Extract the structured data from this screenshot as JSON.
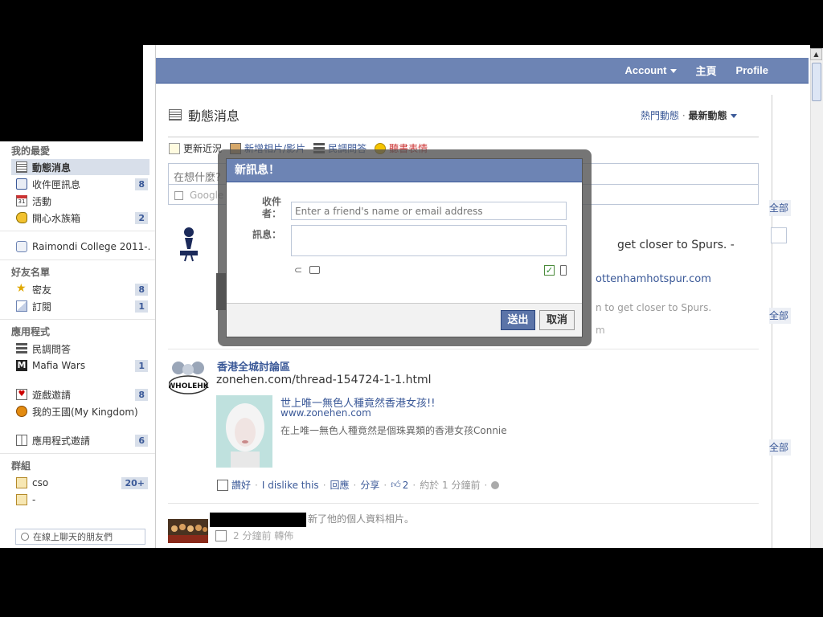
{
  "topbar": {
    "account": "Account",
    "home": "主頁",
    "profile": "Profile"
  },
  "sidebar": {
    "favorites_title": "我的最愛",
    "favorites": [
      {
        "label": "動態消息",
        "count": ""
      },
      {
        "label": "收件匣訊息",
        "count": "8"
      },
      {
        "label": "活動",
        "count": ""
      },
      {
        "label": "開心水族箱",
        "count": "2"
      }
    ],
    "network": "Raimondi College 2011-...",
    "friends_title": "好友名單",
    "friends": [
      {
        "label": "密友",
        "count": "8"
      },
      {
        "label": "訂閱",
        "count": "1"
      }
    ],
    "apps_title": "應用程式",
    "apps": [
      {
        "label": "民調問答",
        "count": ""
      },
      {
        "label": "Mafia Wars",
        "count": "1"
      },
      {
        "label": "遊戲邀請",
        "count": "8"
      },
      {
        "label": "我的王國(My Kingdom)",
        "count": ""
      },
      {
        "label": "應用程式邀請",
        "count": "6"
      }
    ],
    "groups_title": "群組",
    "groups": [
      {
        "label": "cso",
        "count": "20+"
      },
      {
        "label": "-",
        "count": ""
      }
    ],
    "chat_placeholder": "在線上聊天的朋友們"
  },
  "feed": {
    "title": "動態消息",
    "top_news": "熱門動態",
    "dot": "·",
    "most_recent": "最新動態",
    "composer_tabs": [
      "更新近況",
      "新增相片/影片",
      "民調問答",
      "聽書表情"
    ],
    "composer_placeholder": "在想什麼?",
    "google_row": "Google"
  },
  "side_tabs": [
    "全部",
    "全部",
    "全部"
  ],
  "story1": {
    "line1": "get closer to Spurs. -",
    "link": "ottenhamhotspur.com",
    "desc": "n to get closer to Spurs.",
    "time": "m"
  },
  "story2": {
    "name": "香港全城討論區",
    "avatar_text": "WHOLEHK",
    "url": "zonehen.com/thread-154724-1-1.html",
    "attachment_title": "世上唯一無色人種竟然香港女孩!!",
    "attachment_url": "www.zonehen.com",
    "attachment_desc": "在上唯一無色人種竟然是個珠異類的香港女孩Connie",
    "actions": {
      "like": "讚好",
      "dislike": "I dislike this",
      "comment": "回應",
      "share": "分享",
      "likes_count": "2",
      "time": "約於 1 分鐘前"
    }
  },
  "story3": {
    "text": "新了他的個人資料相片。",
    "time": "2 分鐘前 轉佈"
  },
  "dialog": {
    "title": "新訊息！",
    "to_label": "收件者：",
    "to_placeholder": "Enter a friend's name or email address",
    "message_label": "訊息：",
    "send": "送出",
    "cancel": "取消"
  },
  "colors": {
    "brand": "#3b5998",
    "header": "#6d84b4",
    "badge_bg": "#d8dfea"
  }
}
